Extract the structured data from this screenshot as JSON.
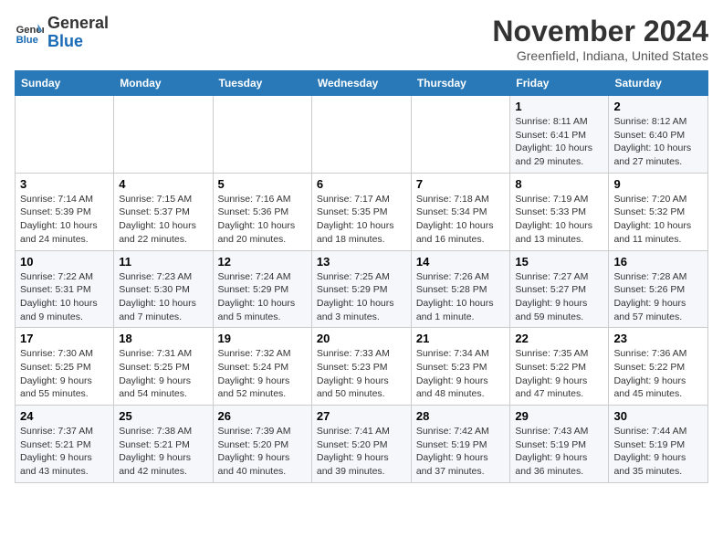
{
  "header": {
    "logo_general": "General",
    "logo_blue": "Blue",
    "month_title": "November 2024",
    "subtitle": "Greenfield, Indiana, United States"
  },
  "columns": [
    "Sunday",
    "Monday",
    "Tuesday",
    "Wednesday",
    "Thursday",
    "Friday",
    "Saturday"
  ],
  "weeks": [
    [
      {
        "day": "",
        "info": ""
      },
      {
        "day": "",
        "info": ""
      },
      {
        "day": "",
        "info": ""
      },
      {
        "day": "",
        "info": ""
      },
      {
        "day": "",
        "info": ""
      },
      {
        "day": "1",
        "info": "Sunrise: 8:11 AM\nSunset: 6:41 PM\nDaylight: 10 hours and 29 minutes."
      },
      {
        "day": "2",
        "info": "Sunrise: 8:12 AM\nSunset: 6:40 PM\nDaylight: 10 hours and 27 minutes."
      }
    ],
    [
      {
        "day": "3",
        "info": "Sunrise: 7:14 AM\nSunset: 5:39 PM\nDaylight: 10 hours and 24 minutes."
      },
      {
        "day": "4",
        "info": "Sunrise: 7:15 AM\nSunset: 5:37 PM\nDaylight: 10 hours and 22 minutes."
      },
      {
        "day": "5",
        "info": "Sunrise: 7:16 AM\nSunset: 5:36 PM\nDaylight: 10 hours and 20 minutes."
      },
      {
        "day": "6",
        "info": "Sunrise: 7:17 AM\nSunset: 5:35 PM\nDaylight: 10 hours and 18 minutes."
      },
      {
        "day": "7",
        "info": "Sunrise: 7:18 AM\nSunset: 5:34 PM\nDaylight: 10 hours and 16 minutes."
      },
      {
        "day": "8",
        "info": "Sunrise: 7:19 AM\nSunset: 5:33 PM\nDaylight: 10 hours and 13 minutes."
      },
      {
        "day": "9",
        "info": "Sunrise: 7:20 AM\nSunset: 5:32 PM\nDaylight: 10 hours and 11 minutes."
      }
    ],
    [
      {
        "day": "10",
        "info": "Sunrise: 7:22 AM\nSunset: 5:31 PM\nDaylight: 10 hours and 9 minutes."
      },
      {
        "day": "11",
        "info": "Sunrise: 7:23 AM\nSunset: 5:30 PM\nDaylight: 10 hours and 7 minutes."
      },
      {
        "day": "12",
        "info": "Sunrise: 7:24 AM\nSunset: 5:29 PM\nDaylight: 10 hours and 5 minutes."
      },
      {
        "day": "13",
        "info": "Sunrise: 7:25 AM\nSunset: 5:29 PM\nDaylight: 10 hours and 3 minutes."
      },
      {
        "day": "14",
        "info": "Sunrise: 7:26 AM\nSunset: 5:28 PM\nDaylight: 10 hours and 1 minute."
      },
      {
        "day": "15",
        "info": "Sunrise: 7:27 AM\nSunset: 5:27 PM\nDaylight: 9 hours and 59 minutes."
      },
      {
        "day": "16",
        "info": "Sunrise: 7:28 AM\nSunset: 5:26 PM\nDaylight: 9 hours and 57 minutes."
      }
    ],
    [
      {
        "day": "17",
        "info": "Sunrise: 7:30 AM\nSunset: 5:25 PM\nDaylight: 9 hours and 55 minutes."
      },
      {
        "day": "18",
        "info": "Sunrise: 7:31 AM\nSunset: 5:25 PM\nDaylight: 9 hours and 54 minutes."
      },
      {
        "day": "19",
        "info": "Sunrise: 7:32 AM\nSunset: 5:24 PM\nDaylight: 9 hours and 52 minutes."
      },
      {
        "day": "20",
        "info": "Sunrise: 7:33 AM\nSunset: 5:23 PM\nDaylight: 9 hours and 50 minutes."
      },
      {
        "day": "21",
        "info": "Sunrise: 7:34 AM\nSunset: 5:23 PM\nDaylight: 9 hours and 48 minutes."
      },
      {
        "day": "22",
        "info": "Sunrise: 7:35 AM\nSunset: 5:22 PM\nDaylight: 9 hours and 47 minutes."
      },
      {
        "day": "23",
        "info": "Sunrise: 7:36 AM\nSunset: 5:22 PM\nDaylight: 9 hours and 45 minutes."
      }
    ],
    [
      {
        "day": "24",
        "info": "Sunrise: 7:37 AM\nSunset: 5:21 PM\nDaylight: 9 hours and 43 minutes."
      },
      {
        "day": "25",
        "info": "Sunrise: 7:38 AM\nSunset: 5:21 PM\nDaylight: 9 hours and 42 minutes."
      },
      {
        "day": "26",
        "info": "Sunrise: 7:39 AM\nSunset: 5:20 PM\nDaylight: 9 hours and 40 minutes."
      },
      {
        "day": "27",
        "info": "Sunrise: 7:41 AM\nSunset: 5:20 PM\nDaylight: 9 hours and 39 minutes."
      },
      {
        "day": "28",
        "info": "Sunrise: 7:42 AM\nSunset: 5:19 PM\nDaylight: 9 hours and 37 minutes."
      },
      {
        "day": "29",
        "info": "Sunrise: 7:43 AM\nSunset: 5:19 PM\nDaylight: 9 hours and 36 minutes."
      },
      {
        "day": "30",
        "info": "Sunrise: 7:44 AM\nSunset: 5:19 PM\nDaylight: 9 hours and 35 minutes."
      }
    ]
  ]
}
